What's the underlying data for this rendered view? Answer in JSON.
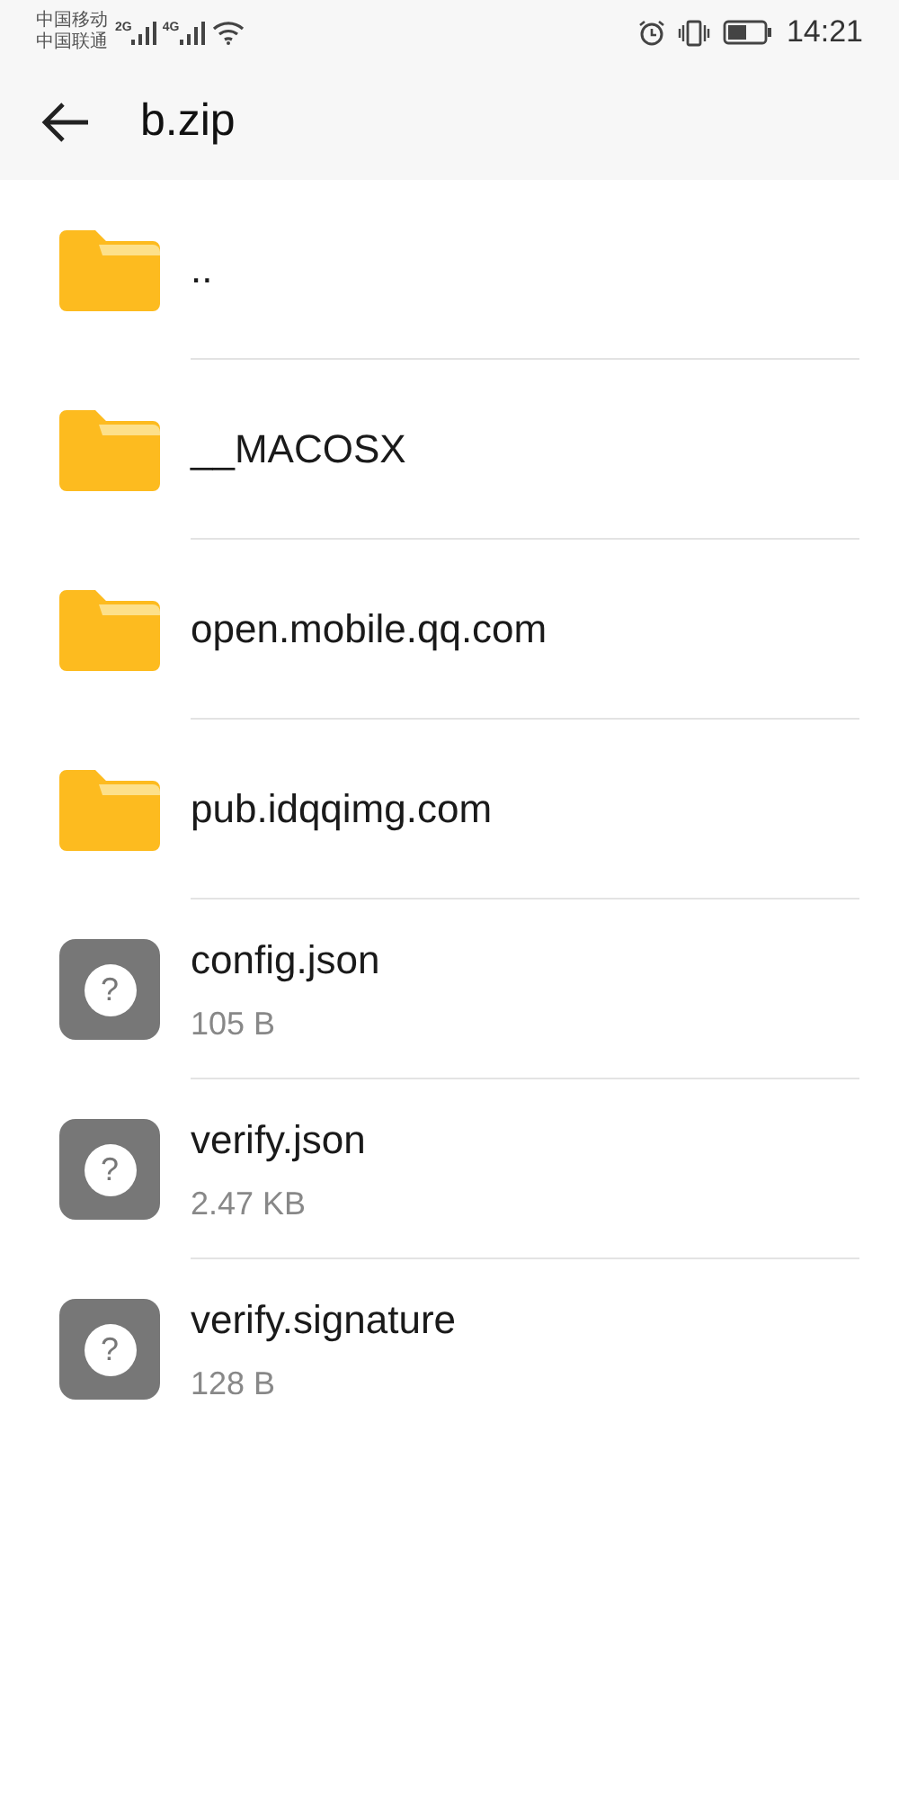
{
  "status_bar": {
    "carriers": [
      "中国移动",
      "中国联通"
    ],
    "signals": [
      "2G",
      "4G"
    ],
    "time": "14:21"
  },
  "header": {
    "title": "b.zip"
  },
  "items": [
    {
      "kind": "folder",
      "name": ".."
    },
    {
      "kind": "folder",
      "name": "__MACOSX"
    },
    {
      "kind": "folder",
      "name": "open.mobile.qq.com"
    },
    {
      "kind": "folder",
      "name": "pub.idqqimg.com"
    },
    {
      "kind": "file",
      "name": "config.json",
      "size": "105 B",
      "icon": "?"
    },
    {
      "kind": "file",
      "name": "verify.json",
      "size": "2.47 KB",
      "icon": "?"
    },
    {
      "kind": "file",
      "name": "verify.signature",
      "size": "128 B",
      "icon": "?"
    }
  ]
}
